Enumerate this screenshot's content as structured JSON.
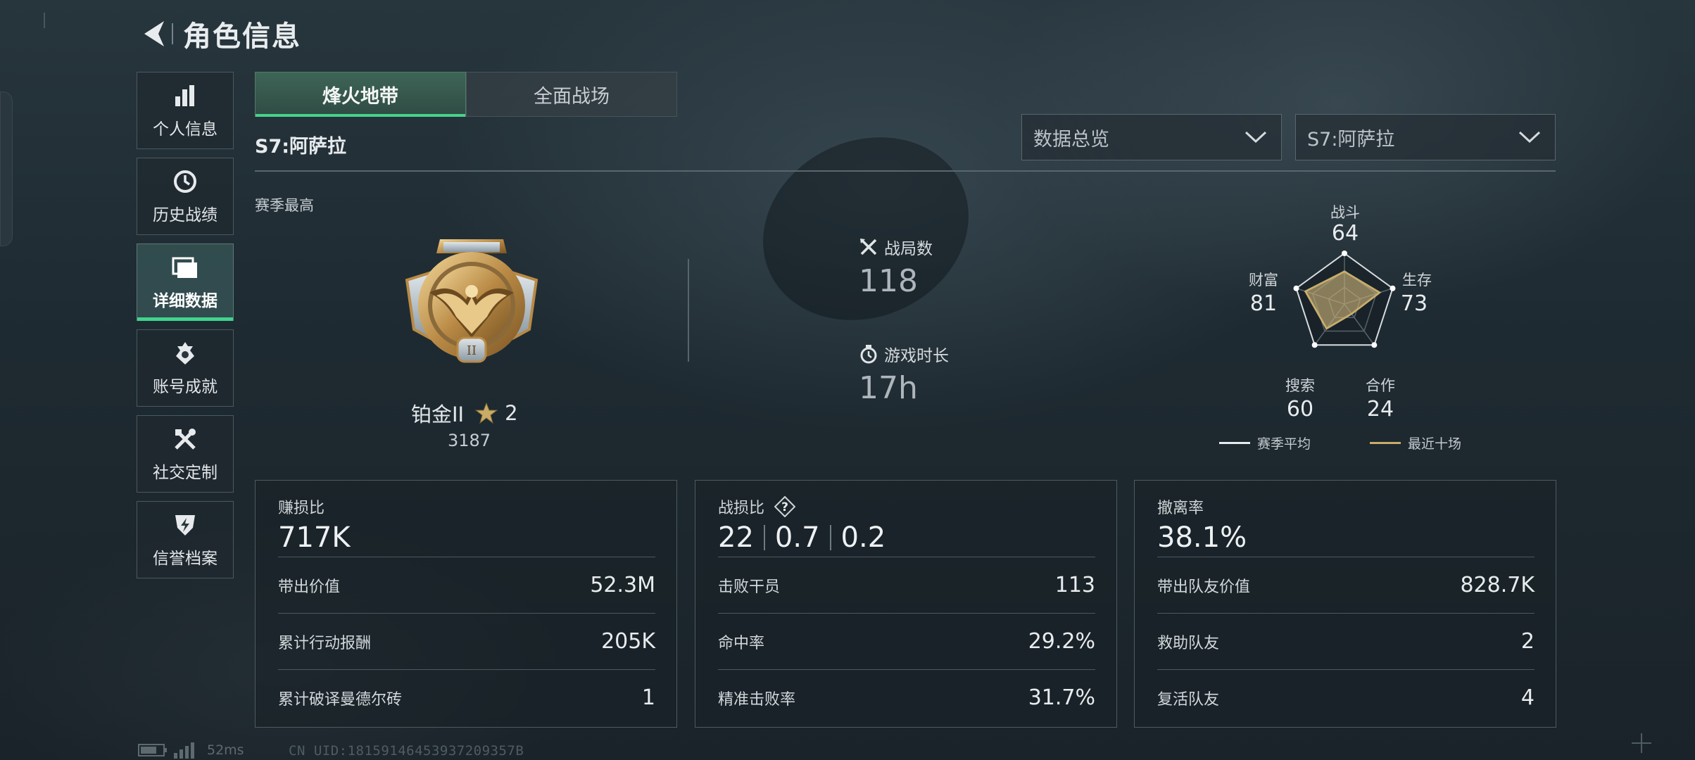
{
  "header": {
    "title": "角色信息"
  },
  "sidebar": {
    "items": [
      {
        "label": "个人信息",
        "icon": "bar-chart-icon",
        "active": false
      },
      {
        "label": "历史战绩",
        "icon": "clock-history-icon",
        "active": false
      },
      {
        "label": "详细数据",
        "icon": "folder-icon",
        "active": true
      },
      {
        "label": "账号成就",
        "icon": "achievement-icon",
        "active": false
      },
      {
        "label": "社交定制",
        "icon": "tools-icon",
        "active": false
      },
      {
        "label": "信誉档案",
        "icon": "shield-bolt-icon",
        "active": false
      }
    ]
  },
  "tabs": [
    {
      "label": "烽火地带",
      "active": true
    },
    {
      "label": "全面战场",
      "active": false
    }
  ],
  "season": {
    "label": "S7:阿萨拉",
    "best_label": "赛季最高"
  },
  "filters": {
    "view": "数据总览",
    "season": "S7:阿萨拉"
  },
  "rank": {
    "name": "铂金II",
    "stars": "2",
    "points": "3187"
  },
  "stats": {
    "matches": {
      "label": "战局数",
      "value": "118",
      "icon": "crossed-swords-icon"
    },
    "playtime": {
      "label": "游戏时长",
      "value": "17h",
      "icon": "stopwatch-icon"
    }
  },
  "radar": {
    "axes": [
      {
        "label": "战斗",
        "value": "64"
      },
      {
        "label": "生存",
        "value": "73"
      },
      {
        "label": "合作",
        "value": "24"
      },
      {
        "label": "搜索",
        "value": "60"
      },
      {
        "label": "财富",
        "value": "81"
      }
    ],
    "season_avg": [
      64,
      73,
      24,
      60,
      81
    ],
    "recent10": [
      64,
      73,
      24,
      60,
      81
    ],
    "legend": {
      "season_avg": "赛季平均",
      "recent10": "最近十场"
    },
    "colors": {
      "season_avg": "#e6ebee",
      "recent10": "#c9ac67"
    }
  },
  "cards": {
    "profit": {
      "title": "赚损比",
      "big": "717K",
      "rows": [
        {
          "label": "带出价值",
          "value": "52.3M"
        },
        {
          "label": "累计行动报酬",
          "value": "205K"
        },
        {
          "label": "累计破译曼德尔砖",
          "value": "1"
        }
      ]
    },
    "combat": {
      "title": "战损比",
      "help": "?",
      "big": [
        "22",
        "0.7",
        "0.2"
      ],
      "rows": [
        {
          "label": "击败干员",
          "value": "113"
        },
        {
          "label": "命中率",
          "value": "29.2%"
        },
        {
          "label": "精准击败率",
          "value": "31.7%"
        }
      ]
    },
    "extract": {
      "title": "撤离率",
      "big": "38.1%",
      "rows": [
        {
          "label": "带出队友价值",
          "value": "828.7K"
        },
        {
          "label": "救助队友",
          "value": "2"
        },
        {
          "label": "复活队友",
          "value": "4"
        }
      ]
    }
  },
  "status": {
    "ping": "52ms",
    "uid": "CN UID:18159146453937209357B"
  },
  "colors": {
    "accent": "#3fd58c",
    "gold": "#c9ac67"
  }
}
